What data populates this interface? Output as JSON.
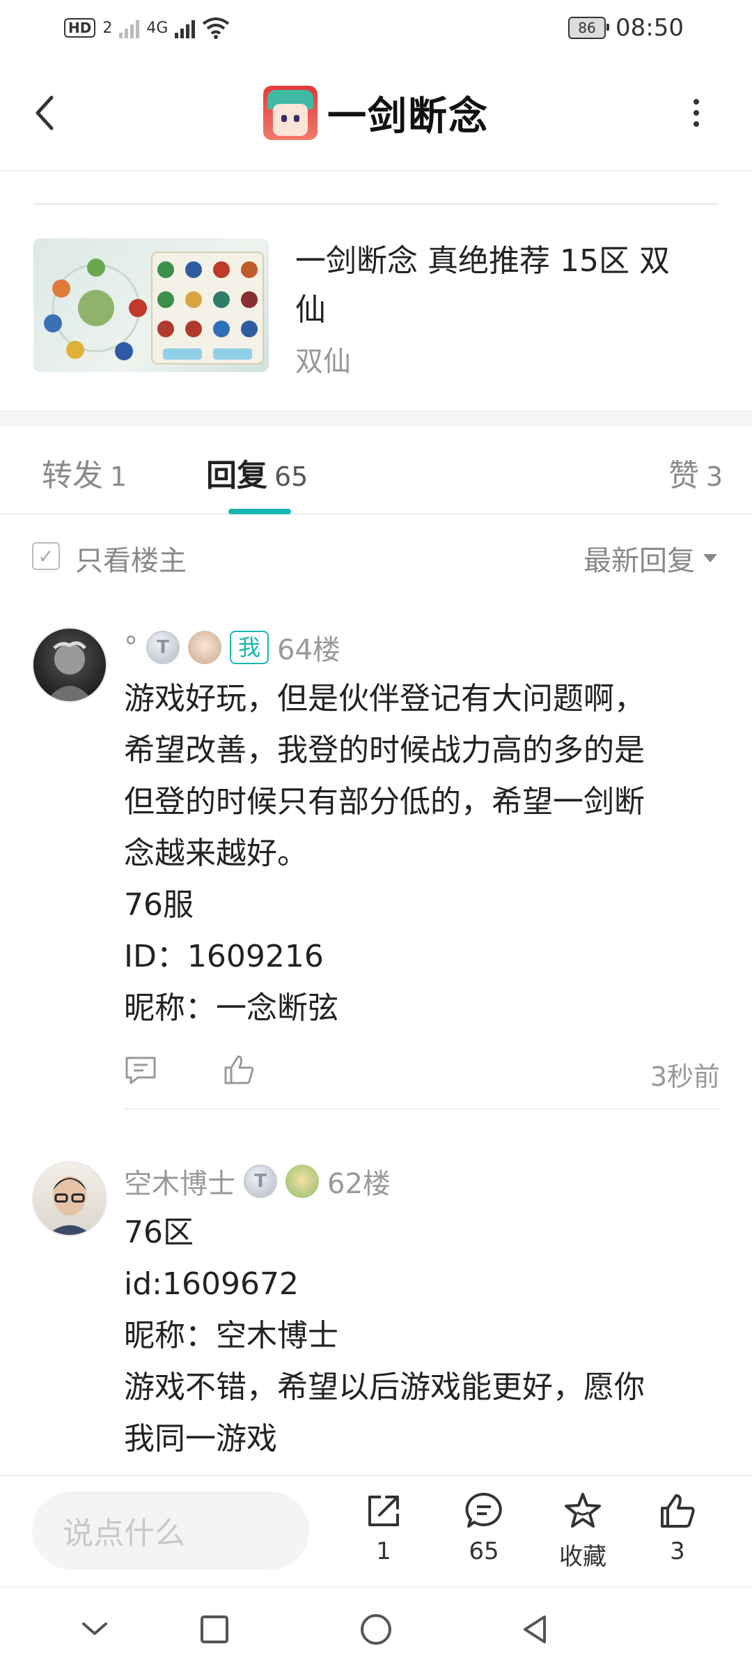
{
  "status_bar": {
    "network_badge": "HD",
    "sim": "2",
    "net_type": "4G",
    "battery": "86",
    "time": "08:50"
  },
  "header": {
    "title": "一剑断念"
  },
  "post": {
    "title_line1": "一剑断念 真绝推荐 15区 双",
    "title_line2": "仙",
    "subtitle": "双仙"
  },
  "tabs": [
    {
      "label": "转发",
      "count": "1"
    },
    {
      "label": "回复",
      "count": "65"
    },
    {
      "label": "赞",
      "count": "3"
    }
  ],
  "filter": {
    "only_op": "只看楼主",
    "sort": "最新回复"
  },
  "comments": [
    {
      "name": "°",
      "badge": "T",
      "me_tag": "我",
      "floor": "64楼",
      "lines": [
        "游戏好玩，但是伙伴登记有大问题啊，",
        "希望改善，我登的时候战力高的多的是",
        "但登的时候只有部分低的，希望一剑断",
        "念越来越好。",
        "76服",
        "ID：1609216",
        "昵称：一念断弦"
      ],
      "time": "3秒前"
    },
    {
      "name": "空木博士",
      "badge": "T",
      "floor": "62楼",
      "lines": [
        "76区",
        "id:1609672",
        "昵称：空木博士",
        "游戏不错，希望以后游戏能更好，愿你",
        "我同一游戏"
      ]
    }
  ],
  "bottom_bar": {
    "input_placeholder": "说点什么",
    "share_count": "1",
    "comment_count": "65",
    "favorite_label": "收藏",
    "like_count": "3"
  },
  "colors": {
    "accent": "#18b6b0"
  }
}
